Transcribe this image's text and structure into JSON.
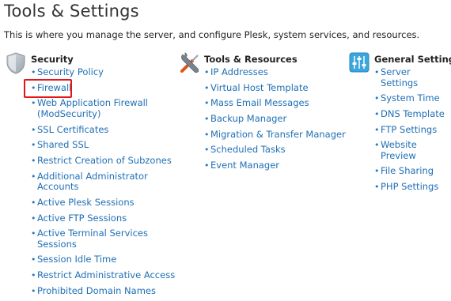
{
  "page": {
    "title": "Tools & Settings",
    "description": "This is where you manage the server, and configure Plesk, system services, and resources."
  },
  "columns": [
    {
      "heading": "Security",
      "icon": "shield-icon",
      "links": [
        "Security Policy",
        "Firewall",
        "Web Application Firewall",
        "(ModSecurity)",
        "SSL Certificates",
        "Shared SSL",
        "Restrict Creation of Subzones",
        "Additional Administrator Accounts",
        "Active Plesk Sessions",
        "Active FTP Sessions",
        "Active Terminal Services Sessions",
        "Session Idle Time",
        "Restrict Administrative Access",
        "Prohibited Domain Names"
      ]
    },
    {
      "heading": "Tools & Resources",
      "icon": "tools-icon",
      "links": [
        "IP Addresses",
        "Virtual Host Template",
        "Mass Email Messages",
        "Backup Manager",
        "Migration & Transfer Manager",
        "Scheduled Tasks",
        "Event Manager"
      ]
    },
    {
      "heading": "General Settings",
      "icon": "sliders-icon",
      "links": [
        "Server Settings",
        "System Time",
        "DNS Template",
        "FTP Settings",
        "Website Preview",
        "File Sharing",
        "PHP Settings"
      ]
    }
  ],
  "colors": {
    "link": "#1f6fb5",
    "highlight_border": "#e3141b",
    "heading": "#222222"
  }
}
